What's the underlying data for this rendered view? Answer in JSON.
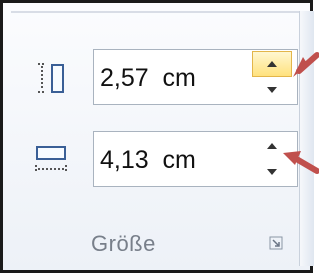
{
  "size_group": {
    "height_field": {
      "value": "2,57  cm",
      "icon": "shape-height-icon"
    },
    "width_field": {
      "value": "4,13  cm",
      "icon": "shape-width-icon"
    },
    "group_label": "Größe",
    "launcher_icon": "dialog-launcher-icon"
  },
  "annotation_color": "#c0504d",
  "accent_color": "#ffe27e"
}
